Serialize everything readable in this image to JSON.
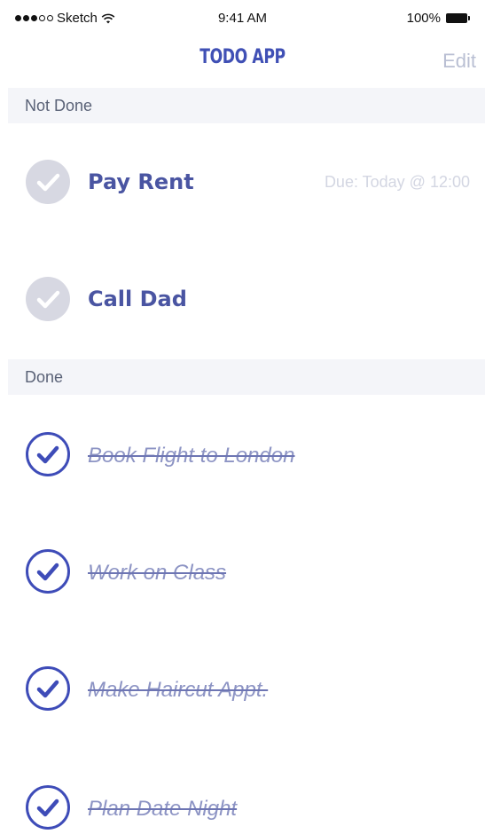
{
  "status_bar": {
    "carrier": "Sketch",
    "time": "9:41 AM",
    "battery_percent": "100%",
    "signal_bars": 5,
    "signal_filled": 3
  },
  "nav": {
    "title": "TODO APP",
    "edit_label": "Edit"
  },
  "sections": {
    "not_done": {
      "label": "Not Done",
      "items": [
        {
          "title": "Pay Rent",
          "due": "Due: Today @ 12:00"
        },
        {
          "title": "Call Dad",
          "due": ""
        }
      ]
    },
    "done": {
      "label": "Done",
      "items": [
        {
          "title": "Book Flight to London"
        },
        {
          "title": "Work on Class"
        },
        {
          "title": "Make Haircut Appt."
        },
        {
          "title": "Plan Date Night"
        }
      ]
    }
  },
  "colors": {
    "accent": "#4050b5",
    "pending_check": "#d7d8e2",
    "section_bg": "#f4f5f9",
    "edit": "#b9bfd3",
    "due": "#d3d6e2"
  },
  "icons": {
    "pending": "check-circle-gray-icon",
    "done": "check-circle-outline-icon",
    "wifi": "wifi-icon",
    "battery": "battery-full-icon"
  }
}
